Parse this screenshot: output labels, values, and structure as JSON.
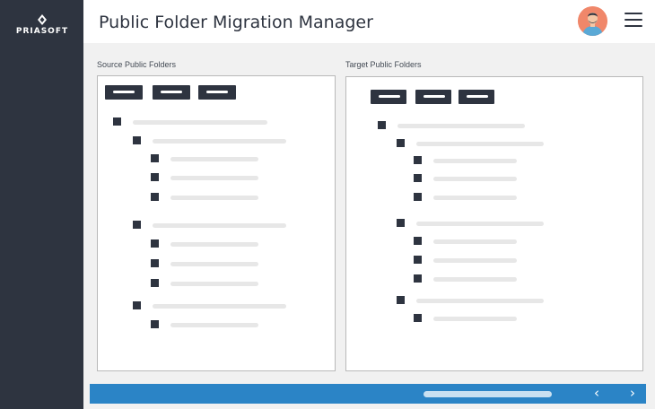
{
  "app": {
    "logo_text": "PRIASOFT",
    "title": "Public Folder Migration Manager"
  },
  "header": {
    "avatar_icon": "user-avatar-icon",
    "menu_icon": "hamburger-menu-icon"
  },
  "panels": {
    "source": {
      "label": "Source Public Folders"
    },
    "target": {
      "label": "Target Public Folders"
    }
  },
  "footer": {
    "prev_label": "‹",
    "next_label": "›"
  },
  "colors": {
    "sidebar": "#2e3440",
    "accent": "#2b84c6",
    "avatar": "#f0876a"
  }
}
